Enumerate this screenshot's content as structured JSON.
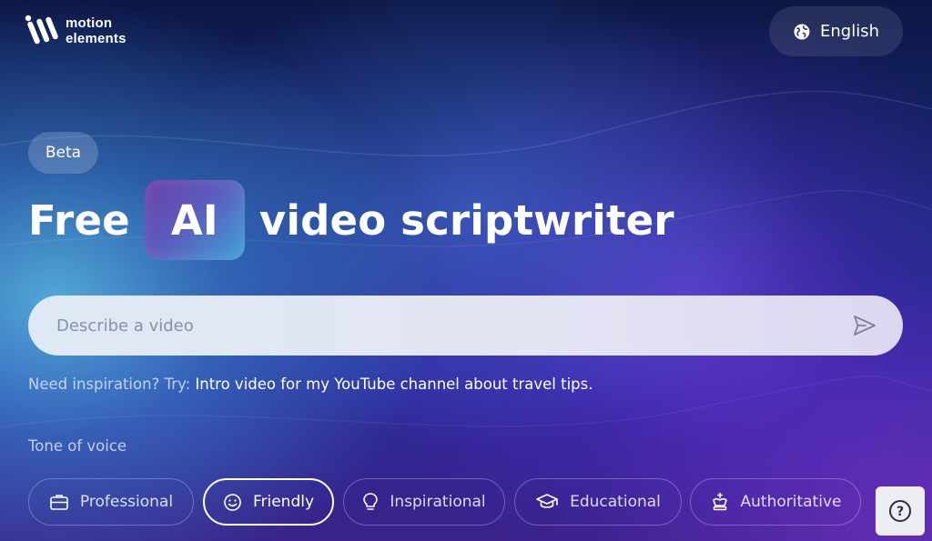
{
  "brand": {
    "line1": "motion",
    "line2": "elements"
  },
  "language": {
    "label": "English",
    "icon": "globe-icon"
  },
  "badge": {
    "label": "Beta"
  },
  "headline": {
    "prefix": "Free",
    "highlight": "AI",
    "suffix": "video scriptwriter"
  },
  "search": {
    "placeholder": "Describe a video",
    "value": "",
    "submit_icon": "send-icon"
  },
  "inspiration": {
    "label": "Need inspiration? Try:",
    "example": "Intro video for my YouTube channel about travel tips."
  },
  "tone": {
    "label": "Tone of voice",
    "selected": "Friendly",
    "options": [
      {
        "label": "Professional",
        "icon": "briefcase-icon"
      },
      {
        "label": "Friendly",
        "icon": "smiley-icon"
      },
      {
        "label": "Inspirational",
        "icon": "lightbulb-icon"
      },
      {
        "label": "Educational",
        "icon": "graduation-cap-icon"
      },
      {
        "label": "Authoritative",
        "icon": "chess-king-icon"
      }
    ]
  },
  "help": {
    "label": "?",
    "icon": "help-icon"
  },
  "colors": {
    "accent_gradient_start": "#6b3fa8",
    "accent_gradient_end": "#3fa0d6",
    "search_background": "#dfe9f6",
    "help_background": "#eceef3"
  }
}
